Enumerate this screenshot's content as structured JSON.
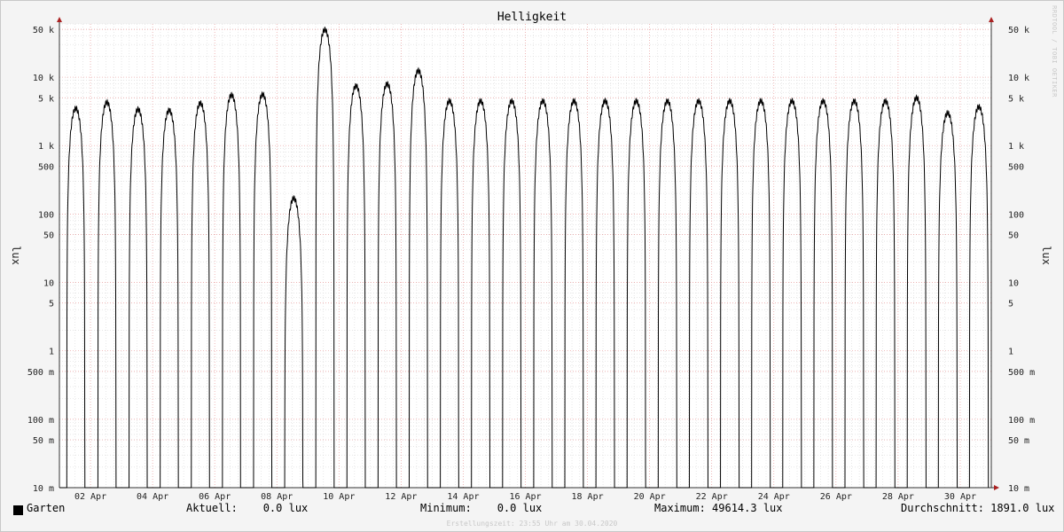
{
  "chart_data": {
    "type": "line",
    "title": "Helligkeit",
    "ylabel": "lux",
    "yscale": "log",
    "ylim": [
      0.01,
      60000
    ],
    "xlim": [
      "2020-04-01",
      "2020-05-01"
    ],
    "grid": true,
    "credit": "RRDTOOL / TOBI OETIKER",
    "y_ticks": [
      {
        "label": "10 m",
        "value": 0.01
      },
      {
        "label": "50 m",
        "value": 0.05
      },
      {
        "label": "100 m",
        "value": 0.1
      },
      {
        "label": "500 m",
        "value": 0.5
      },
      {
        "label": "1",
        "value": 1
      },
      {
        "label": "5",
        "value": 5
      },
      {
        "label": "10",
        "value": 10
      },
      {
        "label": "50",
        "value": 50
      },
      {
        "label": "100",
        "value": 100
      },
      {
        "label": "500",
        "value": 500
      },
      {
        "label": "1 k",
        "value": 1000
      },
      {
        "label": "5 k",
        "value": 5000
      },
      {
        "label": "10 k",
        "value": 10000
      },
      {
        "label": "50 k",
        "value": 50000
      }
    ],
    "x_ticks": [
      {
        "label": "02 Apr",
        "value": "2020-04-02"
      },
      {
        "label": "04 Apr",
        "value": "2020-04-04"
      },
      {
        "label": "06 Apr",
        "value": "2020-04-06"
      },
      {
        "label": "08 Apr",
        "value": "2020-04-08"
      },
      {
        "label": "10 Apr",
        "value": "2020-04-10"
      },
      {
        "label": "12 Apr",
        "value": "2020-04-12"
      },
      {
        "label": "14 Apr",
        "value": "2020-04-14"
      },
      {
        "label": "16 Apr",
        "value": "2020-04-16"
      },
      {
        "label": "18 Apr",
        "value": "2020-04-18"
      },
      {
        "label": "20 Apr",
        "value": "2020-04-20"
      },
      {
        "label": "22 Apr",
        "value": "2020-04-22"
      },
      {
        "label": "24 Apr",
        "value": "2020-04-24"
      },
      {
        "label": "26 Apr",
        "value": "2020-04-26"
      },
      {
        "label": "28 Apr",
        "value": "2020-04-28"
      },
      {
        "label": "30 Apr",
        "value": "2020-04-30"
      }
    ],
    "series": [
      {
        "name": "Garten",
        "color": "#000000",
        "daily_peaks": [
          {
            "date": "2020-04-01",
            "peak": 3500
          },
          {
            "date": "2020-04-02",
            "peak": 4300
          },
          {
            "date": "2020-04-03",
            "peak": 3400
          },
          {
            "date": "2020-04-04",
            "peak": 3300
          },
          {
            "date": "2020-04-05",
            "peak": 4200
          },
          {
            "date": "2020-04-06",
            "peak": 5500
          },
          {
            "date": "2020-04-07",
            "peak": 5600
          },
          {
            "date": "2020-04-08",
            "peak": 170
          },
          {
            "date": "2020-04-09",
            "peak": 49614
          },
          {
            "date": "2020-04-10",
            "peak": 7500
          },
          {
            "date": "2020-04-11",
            "peak": 8000
          },
          {
            "date": "2020-04-12",
            "peak": 12500
          },
          {
            "date": "2020-04-13",
            "peak": 4500
          },
          {
            "date": "2020-04-14",
            "peak": 4500
          },
          {
            "date": "2020-04-15",
            "peak": 4500
          },
          {
            "date": "2020-04-16",
            "peak": 4500
          },
          {
            "date": "2020-04-17",
            "peak": 4500
          },
          {
            "date": "2020-04-18",
            "peak": 4500
          },
          {
            "date": "2020-04-19",
            "peak": 4500
          },
          {
            "date": "2020-04-20",
            "peak": 4500
          },
          {
            "date": "2020-04-21",
            "peak": 4500
          },
          {
            "date": "2020-04-22",
            "peak": 4500
          },
          {
            "date": "2020-04-23",
            "peak": 4500
          },
          {
            "date": "2020-04-24",
            "peak": 4500
          },
          {
            "date": "2020-04-25",
            "peak": 4500
          },
          {
            "date": "2020-04-26",
            "peak": 4500
          },
          {
            "date": "2020-04-27",
            "peak": 4500
          },
          {
            "date": "2020-04-28",
            "peak": 5000
          },
          {
            "date": "2020-04-29",
            "peak": 3000
          },
          {
            "date": "2020-04-30",
            "peak": 3700
          }
        ]
      }
    ]
  },
  "legend": {
    "name": "Garten",
    "current": "Aktuell:    0.0 lux",
    "minimum": "Minimum:    0.0 lux",
    "maximum": "Maximum: 49614.3 lux",
    "average": "Durchschnitt: 1891.0 lux"
  },
  "footnote": "Erstellungszeit: 23:55 Uhr am 30.04.2020",
  "colors": {
    "background": "#f4f4f4",
    "canvas": "#ffffff",
    "minor_grid": "#d8d8d8",
    "major_grid": "#e89a9a",
    "line": "#000000",
    "arrow": "#aa2222"
  }
}
